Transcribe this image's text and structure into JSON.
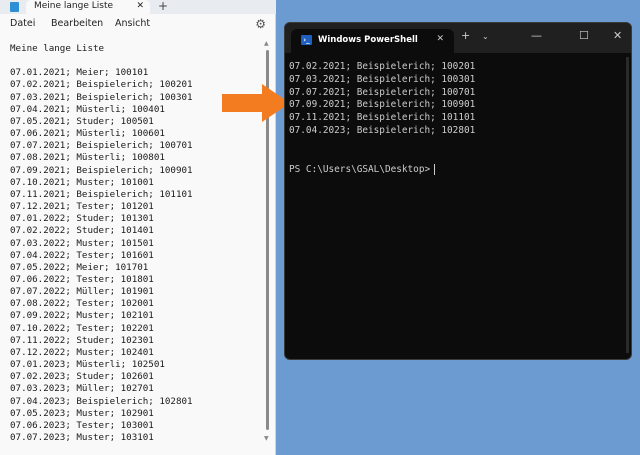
{
  "notepad": {
    "tab_title": "Meine lange Liste",
    "menu": [
      "Datei",
      "Bearbeiten",
      "Ansicht"
    ],
    "heading": "Meine lange Liste",
    "lines": [
      "07.01.2021; Meier; 100101",
      "07.02.2021; Beispielerich; 100201",
      "07.03.2021; Beispielerich; 100301",
      "07.04.2021; Müsterli; 100401",
      "07.05.2021; Studer; 100501",
      "07.06.2021; Müsterli; 100601",
      "07.07.2021; Beispielerich; 100701",
      "07.08.2021; Müsterli; 100801",
      "07.09.2021; Beispielerich; 100901",
      "07.10.2021; Muster; 101001",
      "07.11.2021; Beispielerich; 101101",
      "07.12.2021; Tester; 101201",
      "07.01.2022; Studer; 101301",
      "07.02.2022; Studer; 101401",
      "07.03.2022; Muster; 101501",
      "07.04.2022; Tester; 101601",
      "07.05.2022; Meier; 101701",
      "07.06.2022; Tester; 101801",
      "07.07.2022; Müller; 101901",
      "07.08.2022; Tester; 102001",
      "07.09.2022; Muster; 102101",
      "07.10.2022; Tester; 102201",
      "07.11.2022; Studer; 102301",
      "07.12.2022; Muster; 102401",
      "07.01.2023; Müsterli; 102501",
      "07.02.2023; Studer; 102601",
      "07.03.2023; Müller; 102701",
      "07.04.2023; Beispielerich; 102801",
      "07.05.2023; Muster; 102901",
      "07.06.2023; Tester; 103001",
      "07.07.2023; Muster; 103101"
    ]
  },
  "powershell": {
    "tab_title": "Windows PowerShell",
    "output": [
      "07.02.2021; Beispielerich; 100201",
      "07.03.2021; Beispielerich; 100301",
      "07.07.2021; Beispielerich; 100701",
      "07.09.2021; Beispielerich; 100901",
      "07.11.2021; Beispielerich; 101101",
      "07.04.2023; Beispielerich; 102801"
    ],
    "prompt": "PS C:\\Users\\GSAL\\Desktop>"
  },
  "colors": {
    "desktop": "#6b9bd0",
    "arrow": "#f47c20",
    "terminal_bg": "#0c0c0c"
  }
}
